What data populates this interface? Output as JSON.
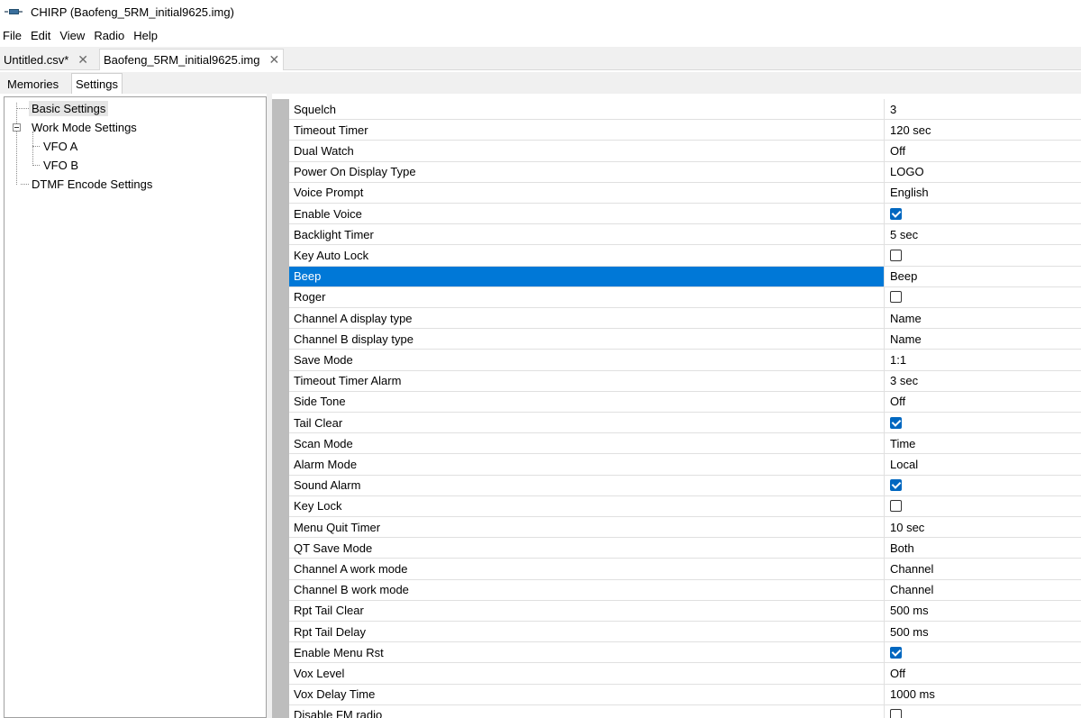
{
  "window": {
    "title": "CHIRP (Baofeng_5RM_initial9625.img)"
  },
  "menu": [
    "File",
    "Edit",
    "View",
    "Radio",
    "Help"
  ],
  "file_tabs": [
    {
      "label": "Untitled.csv*",
      "close": "✕"
    },
    {
      "label": "Baofeng_5RM_initial9625.img",
      "close": "✕"
    }
  ],
  "sub_tabs": [
    "Memories",
    "Settings"
  ],
  "tree": {
    "items": [
      {
        "label": "Basic Settings"
      },
      {
        "label": "Work Mode Settings"
      },
      {
        "label": "VFO A"
      },
      {
        "label": "VFO B"
      },
      {
        "label": "DTMF Encode Settings"
      }
    ]
  },
  "settings": [
    {
      "name": "Squelch",
      "value": "3"
    },
    {
      "name": "Timeout Timer",
      "value": "120 sec"
    },
    {
      "name": "Dual Watch",
      "value": "Off"
    },
    {
      "name": "Power On Display Type",
      "value": "LOGO"
    },
    {
      "name": "Voice Prompt",
      "value": "English"
    },
    {
      "name": "Enable Voice",
      "checkbox": true,
      "checked": true
    },
    {
      "name": "Backlight Timer",
      "value": "5 sec"
    },
    {
      "name": "Key Auto Lock",
      "checkbox": true,
      "checked": false
    },
    {
      "name": "Beep",
      "value": "Beep",
      "selected": true
    },
    {
      "name": "Roger",
      "checkbox": true,
      "checked": false
    },
    {
      "name": "Channel A display type",
      "value": "Name"
    },
    {
      "name": "Channel B display type",
      "value": "Name"
    },
    {
      "name": "Save Mode",
      "value": "1:1"
    },
    {
      "name": "Timeout Timer Alarm",
      "value": "3 sec"
    },
    {
      "name": "Side Tone",
      "value": "Off"
    },
    {
      "name": "Tail Clear",
      "checkbox": true,
      "checked": true
    },
    {
      "name": "Scan Mode",
      "value": "Time"
    },
    {
      "name": "Alarm Mode",
      "value": "Local"
    },
    {
      "name": "Sound Alarm",
      "checkbox": true,
      "checked": true
    },
    {
      "name": "Key Lock",
      "checkbox": true,
      "checked": false
    },
    {
      "name": "Menu Quit Timer",
      "value": "10 sec"
    },
    {
      "name": "QT Save Mode",
      "value": "Both"
    },
    {
      "name": "Channel A work mode",
      "value": "Channel"
    },
    {
      "name": "Channel B work mode",
      "value": "Channel"
    },
    {
      "name": "Rpt Tail Clear",
      "value": "500 ms"
    },
    {
      "name": "Rpt Tail Delay",
      "value": "500 ms"
    },
    {
      "name": "Enable Menu Rst",
      "checkbox": true,
      "checked": true
    },
    {
      "name": "Vox Level",
      "value": "Off"
    },
    {
      "name": "Vox Delay Time",
      "value": "1000 ms"
    },
    {
      "name": "Disable FM radio",
      "checkbox": true,
      "checked": false
    }
  ],
  "colors": {
    "selection": "#0078d7",
    "checkbox_on": "#0067c0"
  }
}
